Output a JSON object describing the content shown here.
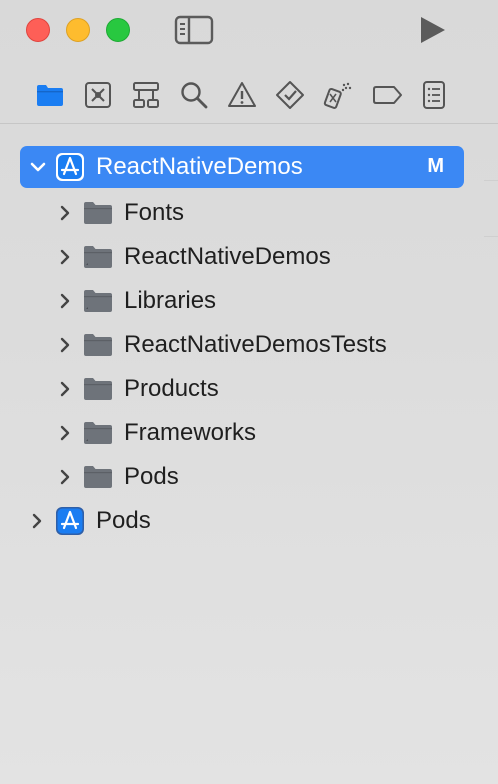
{
  "window": {
    "controls": [
      "close",
      "minimize",
      "zoom"
    ],
    "toolbar_icons": [
      "sidebar-toggle-icon",
      "play-icon"
    ]
  },
  "navigator_tabs": [
    {
      "name": "folder-icon",
      "selected": true
    },
    {
      "name": "source-control-icon",
      "selected": false
    },
    {
      "name": "hierarchy-icon",
      "selected": false
    },
    {
      "name": "search-icon",
      "selected": false
    },
    {
      "name": "warning-icon",
      "selected": false
    },
    {
      "name": "test-diamond-icon",
      "selected": false
    },
    {
      "name": "debug-spray-icon",
      "selected": false
    },
    {
      "name": "breakpoint-icon",
      "selected": false
    },
    {
      "name": "report-list-icon",
      "selected": false
    }
  ],
  "colors": {
    "selection": "#3b88f4",
    "accent": "#1a7df2",
    "folder": "#6e737a"
  },
  "tree": {
    "project": {
      "label": "ReactNativeDemos",
      "badge": "M",
      "expanded": true
    },
    "children": [
      {
        "label": "Fonts",
        "type": "folder"
      },
      {
        "label": "ReactNativeDemos",
        "type": "folder"
      },
      {
        "label": "Libraries",
        "type": "folder"
      },
      {
        "label": "ReactNativeDemosTests",
        "type": "folder"
      },
      {
        "label": "Products",
        "type": "folder"
      },
      {
        "label": "Frameworks",
        "type": "folder"
      },
      {
        "label": "Pods",
        "type": "folder"
      }
    ],
    "pods_project": {
      "label": "Pods",
      "expanded": false
    }
  }
}
